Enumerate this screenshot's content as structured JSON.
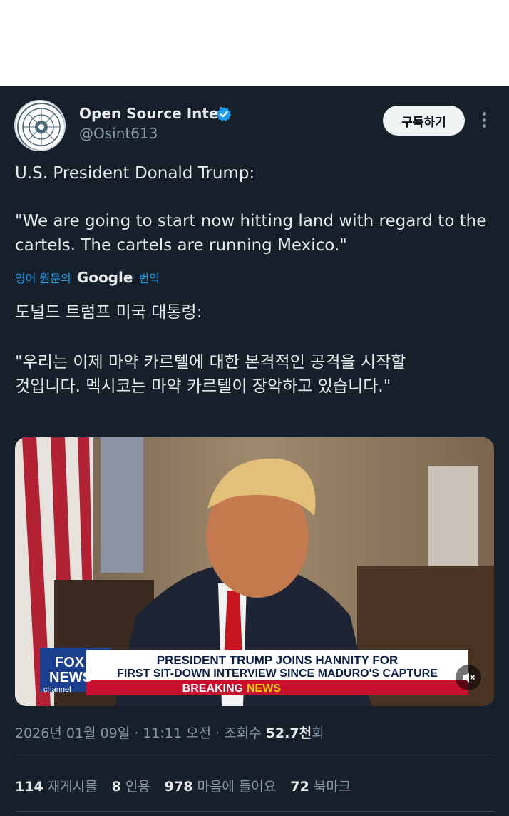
{
  "author": {
    "name": "Open Source Intel",
    "handle": "@Osint613",
    "subscribe_label": "구독하기"
  },
  "tweet": {
    "text_en_line1": "U.S. President Donald Trump:",
    "text_en_quote": "\"We are going to start now hitting land with regard to the cartels. The cartels are running Mexico.\"",
    "translate_prefix": "영어 원문의",
    "translate_brand": "Google",
    "translate_suffix": "번역",
    "text_ko_line1": "도널드 트럼프 미국 대통령:",
    "text_ko_quote": "\"우리는 이제 마약 카르텔에 대한 본격적인 공격을 시작할\n것입니다. 멕시코는 마약 카르텔이 장악하고 있습니다.\""
  },
  "video": {
    "network_logo_top": "FOX",
    "network_logo_mid": "NEWS",
    "network_logo_bottom": "channel",
    "chyron_line1": "PRESIDENT TRUMP JOINS HANNITY FOR",
    "chyron_line2": "FIRST SIT-DOWN INTERVIEW SINCE MADURO'S CAPTURE",
    "breaking_label": "BREAKING",
    "news_label": "NEWS"
  },
  "meta": {
    "date_time": "2026년 01월 09일 · 11:11 오전 · 조회수 ",
    "views": "52.7천",
    "views_suffix": "회"
  },
  "stats": {
    "reposts_count": "114",
    "reposts_label": "재게시물",
    "quotes_count": "8",
    "quotes_label": "인용",
    "likes_count": "978",
    "likes_label": "마음에 들어요",
    "bookmarks_count": "72",
    "bookmarks_label": "북마크"
  },
  "colors": {
    "background": "#15202b",
    "accent": "#1d9bf0",
    "secondary_text": "#8b98a5"
  },
  "icons": [
    "verified-badge-icon",
    "more-options-icon",
    "mute-icon"
  ]
}
